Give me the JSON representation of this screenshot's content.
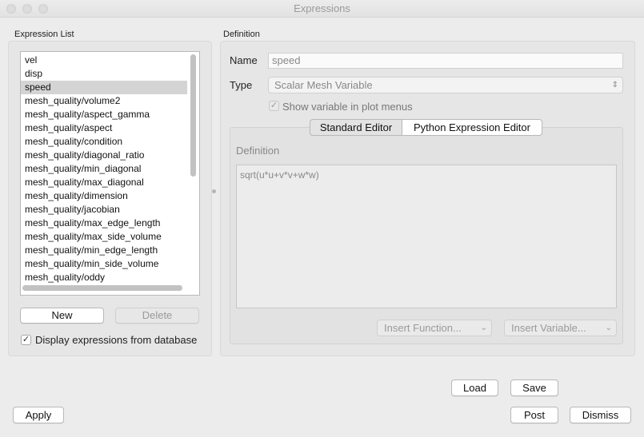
{
  "window": {
    "title": "Expressions"
  },
  "expression_list": {
    "group_label": "Expression List",
    "items": [
      "vel",
      "disp",
      "speed",
      "mesh_quality/volume2",
      "mesh_quality/aspect_gamma",
      "mesh_quality/aspect",
      "mesh_quality/condition",
      "mesh_quality/diagonal_ratio",
      "mesh_quality/min_diagonal",
      "mesh_quality/max_diagonal",
      "mesh_quality/dimension",
      "mesh_quality/jacobian",
      "mesh_quality/max_edge_length",
      "mesh_quality/max_side_volume",
      "mesh_quality/min_edge_length",
      "mesh_quality/min_side_volume",
      "mesh_quality/oddy"
    ],
    "selected_index": 2,
    "new_label": "New",
    "delete_label": "Delete",
    "display_db_label": "Display expressions from database",
    "display_db_checked": true
  },
  "definition": {
    "group_label": "Definition",
    "name_label": "Name",
    "name_value": "speed",
    "type_label": "Type",
    "type_value": "Scalar Mesh Variable",
    "show_in_menus_label": "Show variable in plot menus",
    "show_in_menus_checked": true,
    "tabs": {
      "standard": "Standard Editor",
      "python": "Python Expression Editor"
    },
    "editor_label": "Definition",
    "expression_text": "sqrt(u*u+v*v+w*w)",
    "insert_function_label": "Insert Function...",
    "insert_variable_label": "Insert Variable..."
  },
  "bottom": {
    "load_label": "Load",
    "save_label": "Save",
    "apply_label": "Apply",
    "post_label": "Post",
    "dismiss_label": "Dismiss"
  },
  "icons": {
    "check": "check-icon",
    "updown": "updown-chevron-icon",
    "dropdown": "chevron-down-icon"
  }
}
